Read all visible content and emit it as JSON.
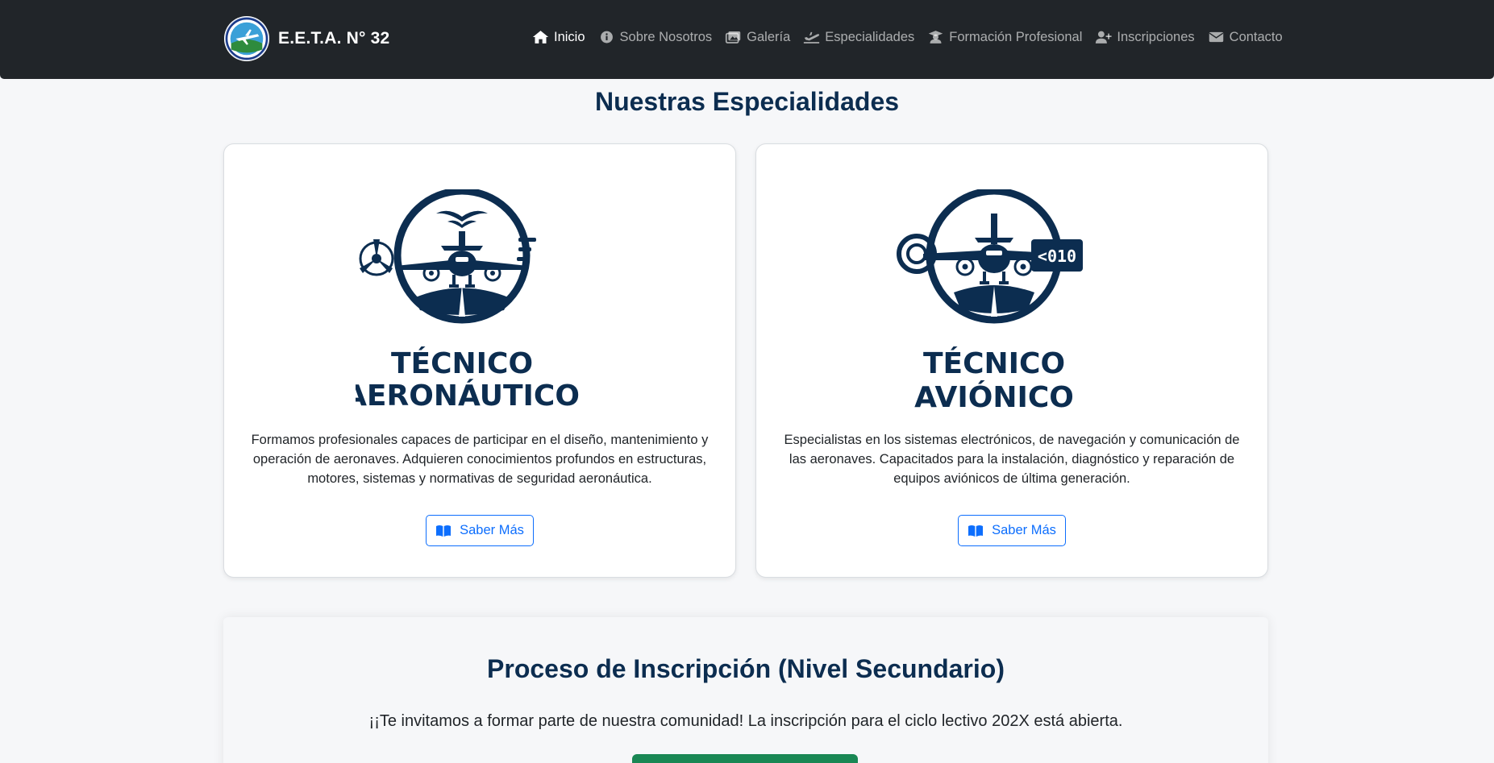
{
  "brand": {
    "name": "E.E.T.A. N° 32"
  },
  "nav": {
    "items": [
      {
        "label": "Inicio",
        "icon": "home-icon",
        "active": true
      },
      {
        "label": "Sobre Nosotros",
        "icon": "info-circle-icon"
      },
      {
        "label": "Galería",
        "icon": "images-icon"
      },
      {
        "label": "Especialidades",
        "icon": "plane-departure-icon"
      },
      {
        "label": "Formación Profesional",
        "icon": "graduate-icon"
      },
      {
        "label": "Inscripciones",
        "icon": "user-plus-icon"
      },
      {
        "label": "Contacto",
        "icon": "envelope-icon"
      }
    ]
  },
  "especialidades": {
    "title": "Nuestras Especialidades",
    "cards": [
      {
        "logo_line1": "TÉCNICO",
        "logo_line2": "AERONÁUTICO",
        "description": "Formamos profesionales capaces de participar en el diseño, mantenimiento y operación de aeronaves. Adquieren conocimientos profundos en estructuras, motores, sistemas y normativas de seguridad aeronáutica.",
        "button": "Saber Más"
      },
      {
        "logo_line1": "TÉCNICO",
        "logo_line2": "AVIÓNICO",
        "logo_badge": "<010",
        "description": "Especialistas en los sistemas electrónicos, de navegación y comunicación de las aeronaves. Capacitados para la instalación, diagnóstico y reparación de equipos aviónicos de última generación.",
        "button": "Saber Más"
      }
    ]
  },
  "inscripcion": {
    "title": "Proceso de Inscripción (Nivel Secundario)",
    "text": "¡¡Te invitamos a formar parte de nuestra comunidad! La inscripción para el ciclo lectivo 202X está abierta."
  },
  "colors": {
    "navbar": "#212529",
    "navy": "#0c2d50",
    "primary": "#0d6efd",
    "success": "#198754"
  }
}
